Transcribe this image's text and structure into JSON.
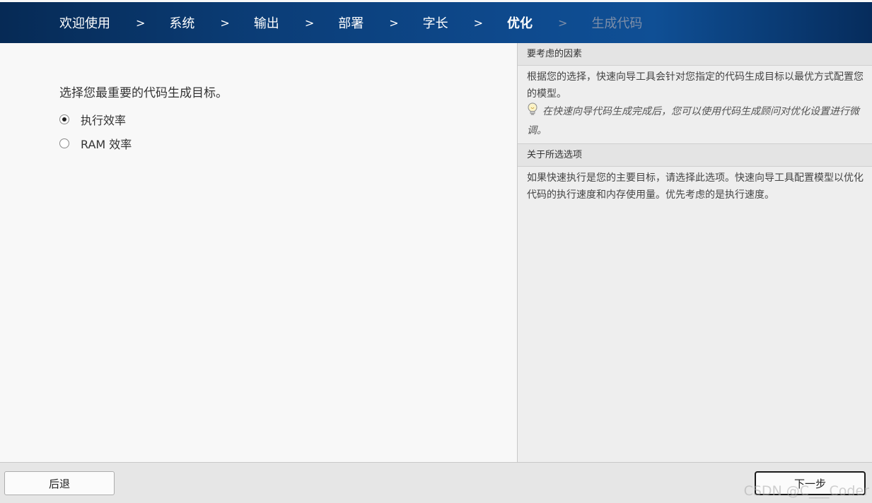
{
  "breadcrumb": {
    "separator": ">",
    "steps": [
      {
        "label": "欢迎使用"
      },
      {
        "label": "系统"
      },
      {
        "label": "输出"
      },
      {
        "label": "部署"
      },
      {
        "label": "字长"
      },
      {
        "label": "优化"
      },
      {
        "label": "生成代码"
      }
    ],
    "active_step": "优化",
    "disabled_step": "生成代码"
  },
  "main": {
    "prompt": "选择您最重要的代码生成目标。",
    "options": [
      {
        "label": "执行效率",
        "selected": true
      },
      {
        "label": "RAM 效率",
        "selected": false
      }
    ]
  },
  "side": {
    "factors": {
      "title": "要考虑的因素",
      "body": "根据您的选择，快速向导工具会针对您指定的代码生成目标以最优方式配置您的模型。",
      "tip": "在快速向导代码生成完成后，您可以使用代码生成顾问对优化设置进行微调。",
      "tip_icon": "lightbulb-icon"
    },
    "about": {
      "title": "关于所选选项",
      "body": "如果快速执行是您的主要目标，请选择此选项。快速向导工具配置模型以优化代码的执行速度和内存使用量。优先考虑的是执行速度。"
    }
  },
  "footer": {
    "back_label": "后退",
    "next_label": "下一步"
  },
  "watermark": "CSDN @C___Coder",
  "colors": {
    "header_dark": "#062a55",
    "header_mid": "#0f4f95",
    "disabled_text": "#7d8ea8"
  }
}
